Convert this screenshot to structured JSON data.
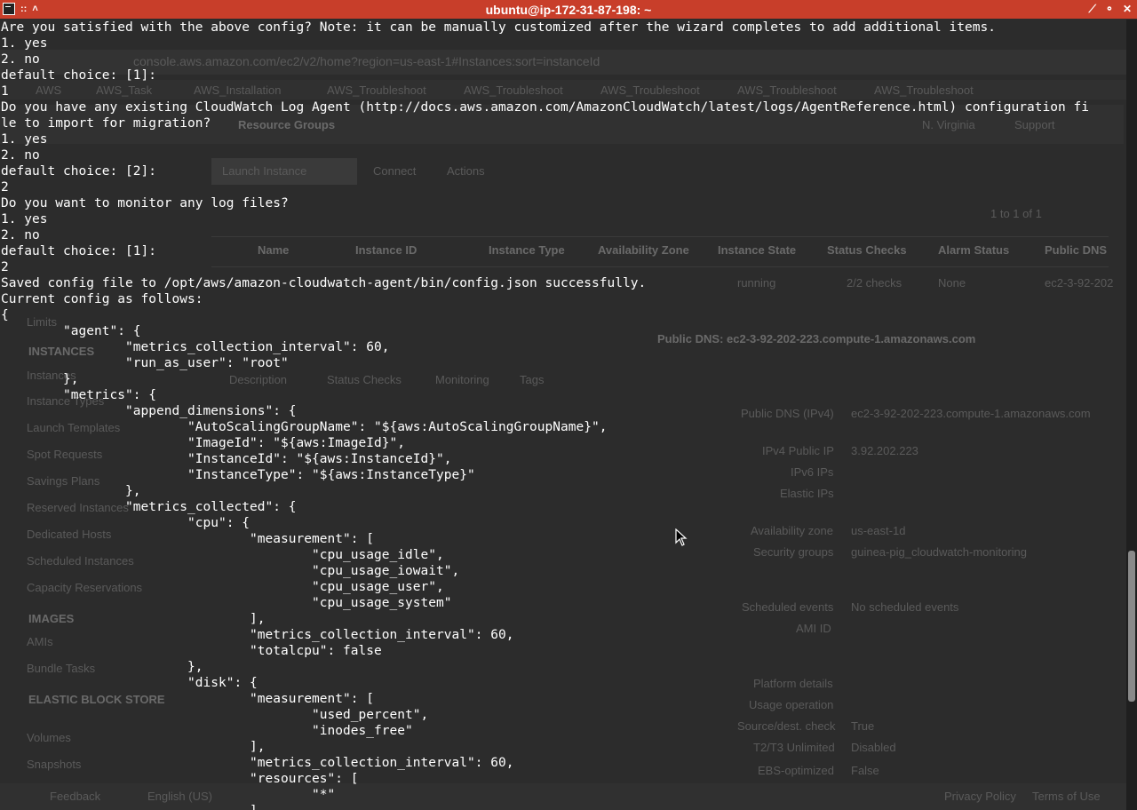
{
  "window": {
    "title": "ubuntu@ip-172-31-87-198: ~",
    "menu_glyph": "::",
    "pin_glyph": "˄",
    "controls": [
      "⟋",
      "⚬",
      "✕"
    ]
  },
  "background_browser": {
    "url": "console.aws.amazon.com/ec2/v2/home?region=us-east-1#Instances:sort=instanceId",
    "bookmarks": [
      "AWS",
      "AWS_Task",
      "AWS_Installation",
      "AWS_Troubleshoot",
      "AWS_Troubleshoot",
      "AWS_Troubleshoot",
      "AWS_Troubleshoot",
      "AWS_Troubleshoot"
    ],
    "header_links": [
      "Resource Groups",
      "N. Virginia",
      "Support"
    ],
    "actions": [
      "Launch Instance",
      "Connect",
      "Actions"
    ],
    "pager": "1 to 1 of 1",
    "columns": [
      "Name",
      "Instance ID",
      "Instance Type",
      "Availability Zone",
      "Instance State",
      "Status Checks",
      "Alarm Status",
      "Public DNS"
    ],
    "row": {
      "state": "running",
      "checks": "2/2 checks",
      "alarm": "None",
      "dns": "ec2-3-92-202"
    },
    "instance_header": "Public DNS: ec2-3-92-202-223.compute-1.amazonaws.com",
    "tabs": [
      "Description",
      "Status Checks",
      "Monitoring",
      "Tags"
    ],
    "sidebar": [
      "Limits",
      "INSTANCES",
      "Instances",
      "Instance Types",
      "Launch Templates",
      "Spot Requests",
      "Savings Plans",
      "Reserved Instances",
      "Dedicated Hosts",
      "Scheduled Instances",
      "Capacity Reservations",
      "IMAGES",
      "AMIs",
      "Bundle Tasks",
      "ELASTIC BLOCK STORE",
      "Volumes",
      "Snapshots"
    ],
    "detail_labels": [
      "Public DNS (IPv4)",
      "IPv4 Public IP",
      "IPv6 IPs",
      "Elastic IPs",
      "Availability zone",
      "Security groups",
      "Scheduled events",
      "AMI ID",
      "Platform details",
      "Usage operation",
      "Source/dest. check",
      "T2/T3 Unlimited",
      "EBS-optimized"
    ],
    "detail_values": [
      "ec2-3-92-202-223.compute-1.amazonaws.com",
      "3.92.202.223",
      "us-east-1d",
      "guinea-pig_cloudwatch-monitoring",
      "No scheduled events",
      "True",
      "Disabled",
      "False"
    ],
    "footer": [
      "Feedback",
      "English (US)",
      "Privacy Policy",
      "Terms of Use"
    ]
  },
  "terminal": {
    "lines": [
      "Are you satisfied with the above config? Note: it can be manually customized after the wizard completes to add additional items.",
      "1. yes",
      "2. no",
      "default choice: [1]:",
      "1",
      "Do you have any existing CloudWatch Log Agent (http://docs.aws.amazon.com/AmazonCloudWatch/latest/logs/AgentReference.html) configuration fi",
      "le to import for migration?",
      "1. yes",
      "2. no",
      "default choice: [2]:",
      "2",
      "Do you want to monitor any log files?",
      "1. yes",
      "2. no",
      "default choice: [1]:",
      "2",
      "Saved config file to /opt/aws/amazon-cloudwatch-agent/bin/config.json successfully.",
      "Current config as follows:",
      "{",
      "        \"agent\": {",
      "                \"metrics_collection_interval\": 60,",
      "                \"run_as_user\": \"root\"",
      "        },",
      "        \"metrics\": {",
      "                \"append_dimensions\": {",
      "                        \"AutoScalingGroupName\": \"${aws:AutoScalingGroupName}\",",
      "                        \"ImageId\": \"${aws:ImageId}\",",
      "                        \"InstanceId\": \"${aws:InstanceId}\",",
      "                        \"InstanceType\": \"${aws:InstanceType}\"",
      "                },",
      "                \"metrics_collected\": {",
      "                        \"cpu\": {",
      "                                \"measurement\": [",
      "                                        \"cpu_usage_idle\",",
      "                                        \"cpu_usage_iowait\",",
      "                                        \"cpu_usage_user\",",
      "                                        \"cpu_usage_system\"",
      "                                ],",
      "                                \"metrics_collection_interval\": 60,",
      "                                \"totalcpu\": false",
      "                        },",
      "                        \"disk\": {",
      "                                \"measurement\": [",
      "                                        \"used_percent\",",
      "                                        \"inodes_free\"",
      "                                ],",
      "                                \"metrics_collection_interval\": 60,",
      "                                \"resources\": [",
      "                                        \"*\"",
      "                                ],"
    ]
  },
  "colors": {
    "titlebar": "#c83e2a",
    "terminal_bg": "#2c2c2c",
    "terminal_fg": "#ffffff"
  }
}
